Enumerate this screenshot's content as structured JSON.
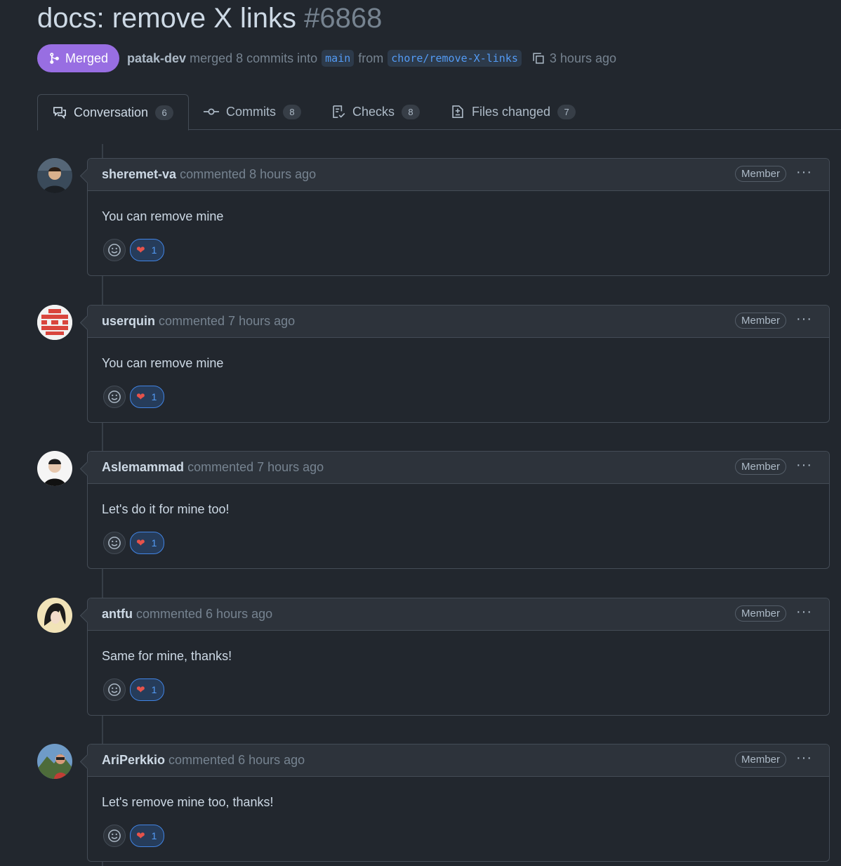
{
  "title": {
    "text": "docs: remove X links",
    "number": "#6868"
  },
  "meta": {
    "status": "Merged",
    "author": "patak-dev",
    "action": "merged 8 commits into",
    "base_branch": "main",
    "from": "from",
    "head_branch": "chore/remove-X-links",
    "time": "3 hours ago"
  },
  "tabs": [
    {
      "label": "Conversation",
      "count": "6",
      "icon": "comment-discussion-icon",
      "active": true
    },
    {
      "label": "Commits",
      "count": "8",
      "icon": "git-commit-icon"
    },
    {
      "label": "Checks",
      "count": "8",
      "icon": "checklist-icon"
    },
    {
      "label": "Files changed",
      "count": "7",
      "icon": "file-diff-icon"
    }
  ],
  "comments": [
    {
      "author": "sheremet-va",
      "action": "commented 8 hours ago",
      "role": "Member",
      "body": "You can remove mine",
      "reaction": "1"
    },
    {
      "author": "userquin",
      "action": "commented 7 hours ago",
      "role": "Member",
      "body": "You can remove mine",
      "reaction": "1"
    },
    {
      "author": "Aslemammad",
      "action": "commented 7 hours ago",
      "role": "Member",
      "body": "Let's do it for mine too!",
      "reaction": "1"
    },
    {
      "author": "antfu",
      "action": "commented 6 hours ago",
      "role": "Member",
      "body": "Same for mine, thanks!",
      "reaction": "1"
    },
    {
      "author": "AriPerkkio",
      "action": "commented 6 hours ago",
      "role": "Member",
      "body": "Let's remove mine too, thanks!",
      "reaction": "1"
    }
  ],
  "colors": {
    "background": "#22272e",
    "merged": "#986ee2",
    "link": "#539bf5",
    "heart": "#e5534b"
  }
}
